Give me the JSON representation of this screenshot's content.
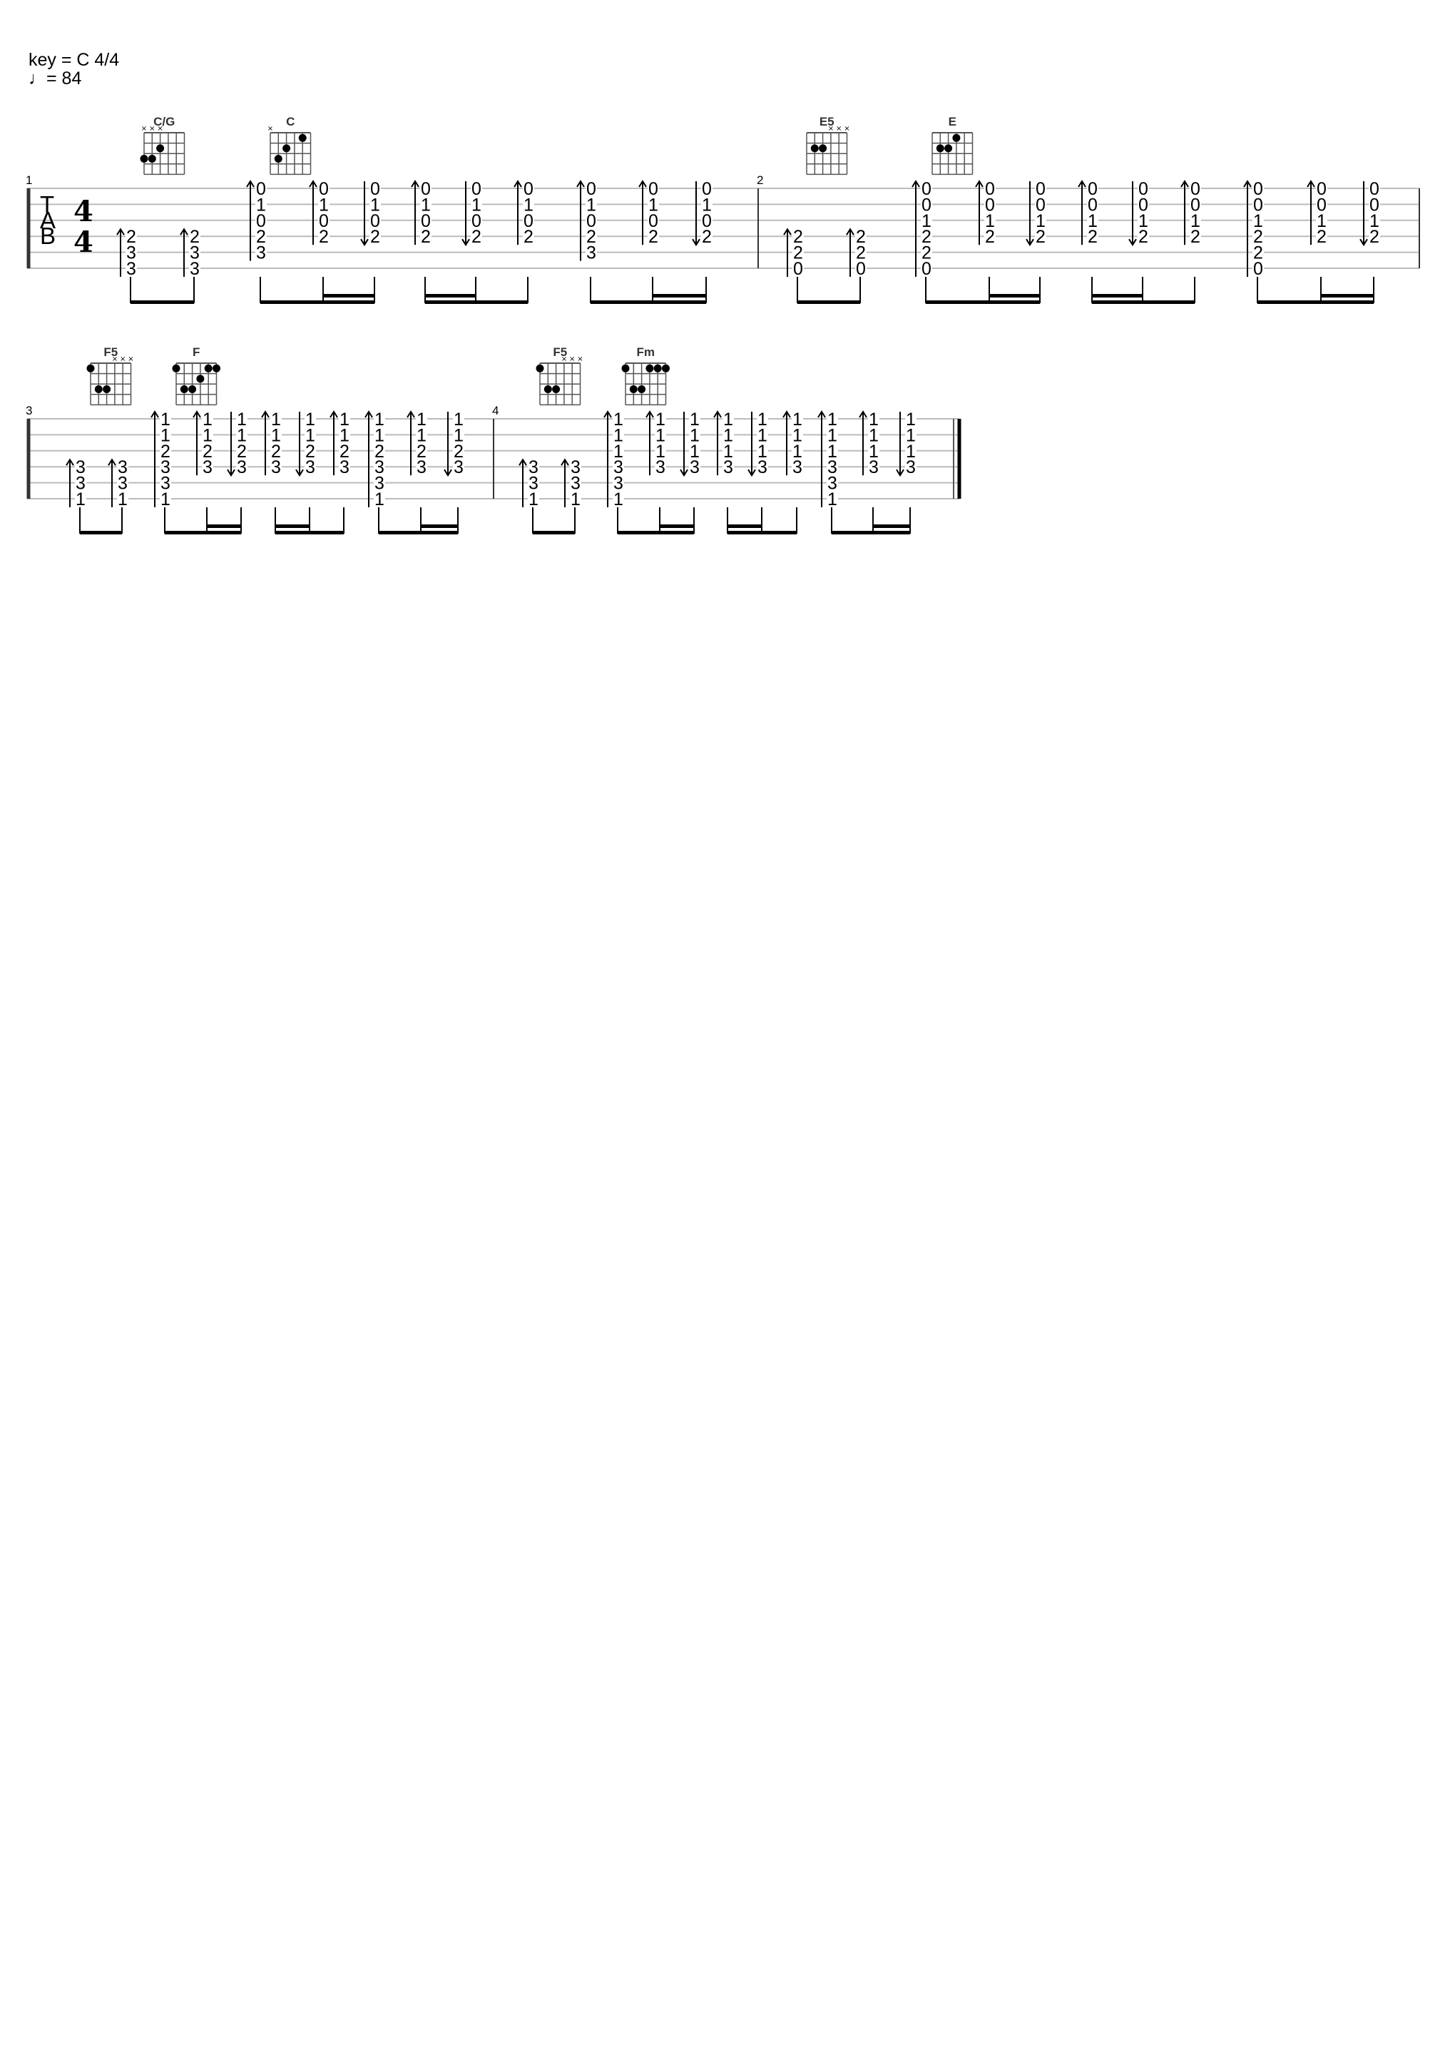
{
  "header": {
    "key_line": "key = C 4/4",
    "tempo_line": "♩= 84"
  },
  "score": {
    "instrument": "guitar-tab",
    "time_signature": {
      "top": "4",
      "bottom": "4"
    },
    "tab_clef": [
      "T",
      "A",
      "B"
    ],
    "systems": [
      {
        "measures": [
          {
            "number": "1",
            "chords": [
              {
                "name": "C/G",
                "muted": [
                  4,
                  5,
                  6
                ],
                "open": [],
                "dots": [
                  [
                    6,
                    3
                  ],
                  [
                    5,
                    3
                  ],
                  [
                    4,
                    2
                  ]
                ]
              },
              {
                "name": "C",
                "muted": [
                  6
                ],
                "open": [],
                "dots": [
                  [
                    5,
                    3
                  ],
                  [
                    4,
                    2
                  ],
                  [
                    2,
                    1
                  ]
                ]
              }
            ],
            "beats": [
              {
                "stroke": "up",
                "frets": {
                  "4": "2",
                  "5": "3",
                  "6": "3"
                }
              },
              {
                "stroke": "up",
                "frets": {
                  "4": "2",
                  "5": "3",
                  "6": "3"
                }
              },
              {
                "stroke": "up",
                "frets": {
                  "1": "0",
                  "2": "1",
                  "3": "0",
                  "4": "2",
                  "5": "3"
                }
              },
              {
                "stroke": "up",
                "frets": {
                  "1": "0",
                  "2": "1",
                  "3": "0",
                  "4": "2"
                }
              },
              {
                "stroke": "down",
                "frets": {
                  "1": "0",
                  "2": "1",
                  "3": "0",
                  "4": "2"
                }
              },
              {
                "stroke": "up",
                "frets": {
                  "1": "0",
                  "2": "1",
                  "3": "0",
                  "4": "2"
                }
              },
              {
                "stroke": "down",
                "frets": {
                  "1": "0",
                  "2": "1",
                  "3": "0",
                  "4": "2"
                }
              },
              {
                "stroke": "up",
                "frets": {
                  "1": "0",
                  "2": "1",
                  "3": "0",
                  "4": "2"
                }
              },
              {
                "stroke": "up",
                "frets": {
                  "1": "0",
                  "2": "1",
                  "3": "0",
                  "4": "2",
                  "5": "3"
                }
              },
              {
                "stroke": "up",
                "frets": {
                  "1": "0",
                  "2": "1",
                  "3": "0",
                  "4": "2"
                }
              },
              {
                "stroke": "down",
                "frets": {
                  "1": "0",
                  "2": "1",
                  "3": "0",
                  "4": "2"
                }
              }
            ],
            "durations": [
              "8",
              "8",
              "8",
              "16",
              "16",
              "16",
              "16",
              "8",
              "8",
              "16",
              "16"
            ]
          },
          {
            "number": "2",
            "chords": [
              {
                "name": "E5",
                "muted": [
                  1,
                  2,
                  3
                ],
                "open": [],
                "dots": [
                  [
                    5,
                    2
                  ],
                  [
                    4,
                    2
                  ]
                ]
              },
              {
                "name": "E",
                "muted": [],
                "open": [],
                "dots": [
                  [
                    5,
                    2
                  ],
                  [
                    4,
                    2
                  ],
                  [
                    3,
                    1
                  ]
                ]
              }
            ],
            "beats": [
              {
                "stroke": "up",
                "frets": {
                  "4": "2",
                  "5": "2",
                  "6": "0"
                }
              },
              {
                "stroke": "up",
                "frets": {
                  "4": "2",
                  "5": "2",
                  "6": "0"
                }
              },
              {
                "stroke": "up",
                "frets": {
                  "1": "0",
                  "2": "0",
                  "3": "1",
                  "4": "2",
                  "5": "2",
                  "6": "0"
                }
              },
              {
                "stroke": "up",
                "frets": {
                  "1": "0",
                  "2": "0",
                  "3": "1",
                  "4": "2"
                }
              },
              {
                "stroke": "down",
                "frets": {
                  "1": "0",
                  "2": "0",
                  "3": "1",
                  "4": "2"
                }
              },
              {
                "stroke": "up",
                "frets": {
                  "1": "0",
                  "2": "0",
                  "3": "1",
                  "4": "2"
                }
              },
              {
                "stroke": "down",
                "frets": {
                  "1": "0",
                  "2": "0",
                  "3": "1",
                  "4": "2"
                }
              },
              {
                "stroke": "up",
                "frets": {
                  "1": "0",
                  "2": "0",
                  "3": "1",
                  "4": "2"
                }
              },
              {
                "stroke": "up",
                "frets": {
                  "1": "0",
                  "2": "0",
                  "3": "1",
                  "4": "2",
                  "5": "2",
                  "6": "0"
                }
              },
              {
                "stroke": "up",
                "frets": {
                  "1": "0",
                  "2": "0",
                  "3": "1",
                  "4": "2"
                }
              },
              {
                "stroke": "down",
                "frets": {
                  "1": "0",
                  "2": "0",
                  "3": "1",
                  "4": "2"
                }
              }
            ],
            "durations": [
              "8",
              "8",
              "8",
              "16",
              "16",
              "16",
              "16",
              "8",
              "8",
              "16",
              "16"
            ]
          }
        ]
      },
      {
        "measures": [
          {
            "number": "3",
            "chords": [
              {
                "name": "F5",
                "muted": [
                  1,
                  2,
                  3
                ],
                "open": [],
                "dots": [
                  [
                    6,
                    1
                  ],
                  [
                    5,
                    3
                  ],
                  [
                    4,
                    3
                  ]
                ]
              },
              {
                "name": "F",
                "muted": [],
                "open": [],
                "dots": [
                  [
                    6,
                    1
                  ],
                  [
                    2,
                    1
                  ],
                  [
                    1,
                    1
                  ],
                  [
                    3,
                    2
                  ],
                  [
                    5,
                    3
                  ],
                  [
                    4,
                    3
                  ]
                ]
              }
            ],
            "beats": [
              {
                "stroke": "up",
                "frets": {
                  "4": "3",
                  "5": "3",
                  "6": "1"
                }
              },
              {
                "stroke": "up",
                "frets": {
                  "4": "3",
                  "5": "3",
                  "6": "1"
                }
              },
              {
                "stroke": "up",
                "frets": {
                  "1": "1",
                  "2": "1",
                  "3": "2",
                  "4": "3",
                  "5": "3",
                  "6": "1"
                }
              },
              {
                "stroke": "up",
                "frets": {
                  "1": "1",
                  "2": "1",
                  "3": "2",
                  "4": "3"
                }
              },
              {
                "stroke": "down",
                "frets": {
                  "1": "1",
                  "2": "1",
                  "3": "2",
                  "4": "3"
                }
              },
              {
                "stroke": "up",
                "frets": {
                  "1": "1",
                  "2": "1",
                  "3": "2",
                  "4": "3"
                }
              },
              {
                "stroke": "down",
                "frets": {
                  "1": "1",
                  "2": "1",
                  "3": "2",
                  "4": "3"
                }
              },
              {
                "stroke": "up",
                "frets": {
                  "1": "1",
                  "2": "1",
                  "3": "2",
                  "4": "3"
                }
              },
              {
                "stroke": "up",
                "frets": {
                  "1": "1",
                  "2": "1",
                  "3": "2",
                  "4": "3",
                  "5": "3",
                  "6": "1"
                }
              },
              {
                "stroke": "up",
                "frets": {
                  "1": "1",
                  "2": "1",
                  "3": "2",
                  "4": "3"
                }
              },
              {
                "stroke": "down",
                "frets": {
                  "1": "1",
                  "2": "1",
                  "3": "2",
                  "4": "3"
                }
              }
            ],
            "durations": [
              "8",
              "8",
              "8",
              "16",
              "16",
              "16",
              "16",
              "8",
              "8",
              "16",
              "16"
            ]
          },
          {
            "number": "4",
            "chords": [
              {
                "name": "F5",
                "muted": [
                  1,
                  2,
                  3
                ],
                "open": [],
                "dots": [
                  [
                    6,
                    1
                  ],
                  [
                    5,
                    3
                  ],
                  [
                    4,
                    3
                  ]
                ]
              },
              {
                "name": "Fm",
                "muted": [],
                "open": [],
                "dots": [
                  [
                    6,
                    1
                  ],
                  [
                    3,
                    1
                  ],
                  [
                    2,
                    1
                  ],
                  [
                    1,
                    1
                  ],
                  [
                    5,
                    3
                  ],
                  [
                    4,
                    3
                  ]
                ]
              }
            ],
            "beats": [
              {
                "stroke": "up",
                "frets": {
                  "4": "3",
                  "5": "3",
                  "6": "1"
                }
              },
              {
                "stroke": "up",
                "frets": {
                  "4": "3",
                  "5": "3",
                  "6": "1"
                }
              },
              {
                "stroke": "up",
                "frets": {
                  "1": "1",
                  "2": "1",
                  "3": "1",
                  "4": "3",
                  "5": "3",
                  "6": "1"
                }
              },
              {
                "stroke": "up",
                "frets": {
                  "1": "1",
                  "2": "1",
                  "3": "1",
                  "4": "3"
                }
              },
              {
                "stroke": "down",
                "frets": {
                  "1": "1",
                  "2": "1",
                  "3": "1",
                  "4": "3"
                }
              },
              {
                "stroke": "up",
                "frets": {
                  "1": "1",
                  "2": "1",
                  "3": "1",
                  "4": "3"
                }
              },
              {
                "stroke": "down",
                "frets": {
                  "1": "1",
                  "2": "1",
                  "3": "1",
                  "4": "3"
                }
              },
              {
                "stroke": "up",
                "frets": {
                  "1": "1",
                  "2": "1",
                  "3": "1",
                  "4": "3"
                }
              },
              {
                "stroke": "up",
                "frets": {
                  "1": "1",
                  "2": "1",
                  "3": "1",
                  "4": "3",
                  "5": "3",
                  "6": "1"
                }
              },
              {
                "stroke": "up",
                "frets": {
                  "1": "1",
                  "2": "1",
                  "3": "1",
                  "4": "3"
                }
              },
              {
                "stroke": "down",
                "frets": {
                  "1": "1",
                  "2": "1",
                  "3": "1",
                  "4": "3"
                }
              }
            ],
            "durations": [
              "8",
              "8",
              "8",
              "16",
              "16",
              "16",
              "16",
              "8",
              "8",
              "16",
              "16"
            ]
          }
        ],
        "final_barline": "end"
      }
    ]
  }
}
